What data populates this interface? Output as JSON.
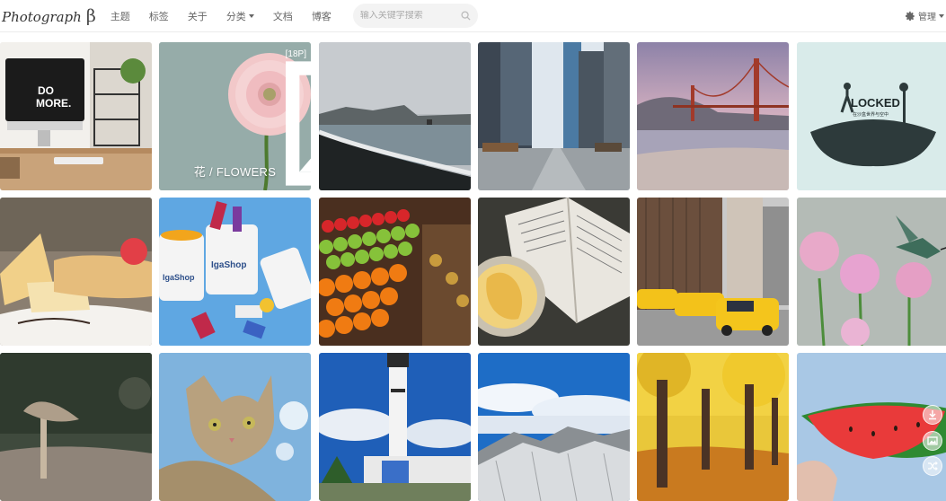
{
  "brand": {
    "name": "Photograph",
    "suffix": "β"
  },
  "nav": [
    {
      "label": "主题",
      "dropdown": false
    },
    {
      "label": "标签",
      "dropdown": false
    },
    {
      "label": "关于",
      "dropdown": false
    },
    {
      "label": "分类",
      "dropdown": true
    },
    {
      "label": "文档",
      "dropdown": false
    },
    {
      "label": "博客",
      "dropdown": false
    }
  ],
  "search": {
    "placeholder": "输入关键字搜索",
    "value": ""
  },
  "admin": {
    "label": "管理"
  },
  "gallery": {
    "tiles": [
      {
        "name": "tile-desk-workspace",
        "caption": "",
        "badge": ""
      },
      {
        "name": "tile-flowers-album",
        "caption": "花 / FLOWERS",
        "badge": "[18P]"
      },
      {
        "name": "tile-coast-beach",
        "caption": "",
        "badge": ""
      },
      {
        "name": "tile-city-street",
        "caption": "",
        "badge": ""
      },
      {
        "name": "tile-golden-gate-bridge",
        "caption": "",
        "badge": ""
      },
      {
        "name": "tile-locked-poster",
        "caption": "",
        "badge": ""
      },
      {
        "name": "tile-cake-dessert",
        "caption": "",
        "badge": ""
      },
      {
        "name": "tile-igashop-mugs",
        "caption": "",
        "badge": ""
      },
      {
        "name": "tile-fruit-market",
        "caption": "",
        "badge": ""
      },
      {
        "name": "tile-open-book",
        "caption": "",
        "badge": ""
      },
      {
        "name": "tile-yellow-taxis",
        "caption": "",
        "badge": ""
      },
      {
        "name": "tile-hummingbird-flowers",
        "caption": "",
        "badge": ""
      },
      {
        "name": "tile-mushroom",
        "caption": "",
        "badge": ""
      },
      {
        "name": "tile-cat",
        "caption": "",
        "badge": ""
      },
      {
        "name": "tile-lighthouse",
        "caption": "",
        "badge": ""
      },
      {
        "name": "tile-snowy-mountains",
        "caption": "",
        "badge": ""
      },
      {
        "name": "tile-autumn-trees",
        "caption": "",
        "badge": ""
      },
      {
        "name": "tile-watermelon",
        "caption": "",
        "badge": ""
      }
    ],
    "poster_text": {
      "title": "LOCKED",
      "subtitle": "在沙盒世界与空中"
    },
    "mug_brand": "IgaShop"
  },
  "tools": [
    {
      "name": "download-icon"
    },
    {
      "name": "image-icon"
    },
    {
      "name": "shuffle-icon"
    }
  ]
}
